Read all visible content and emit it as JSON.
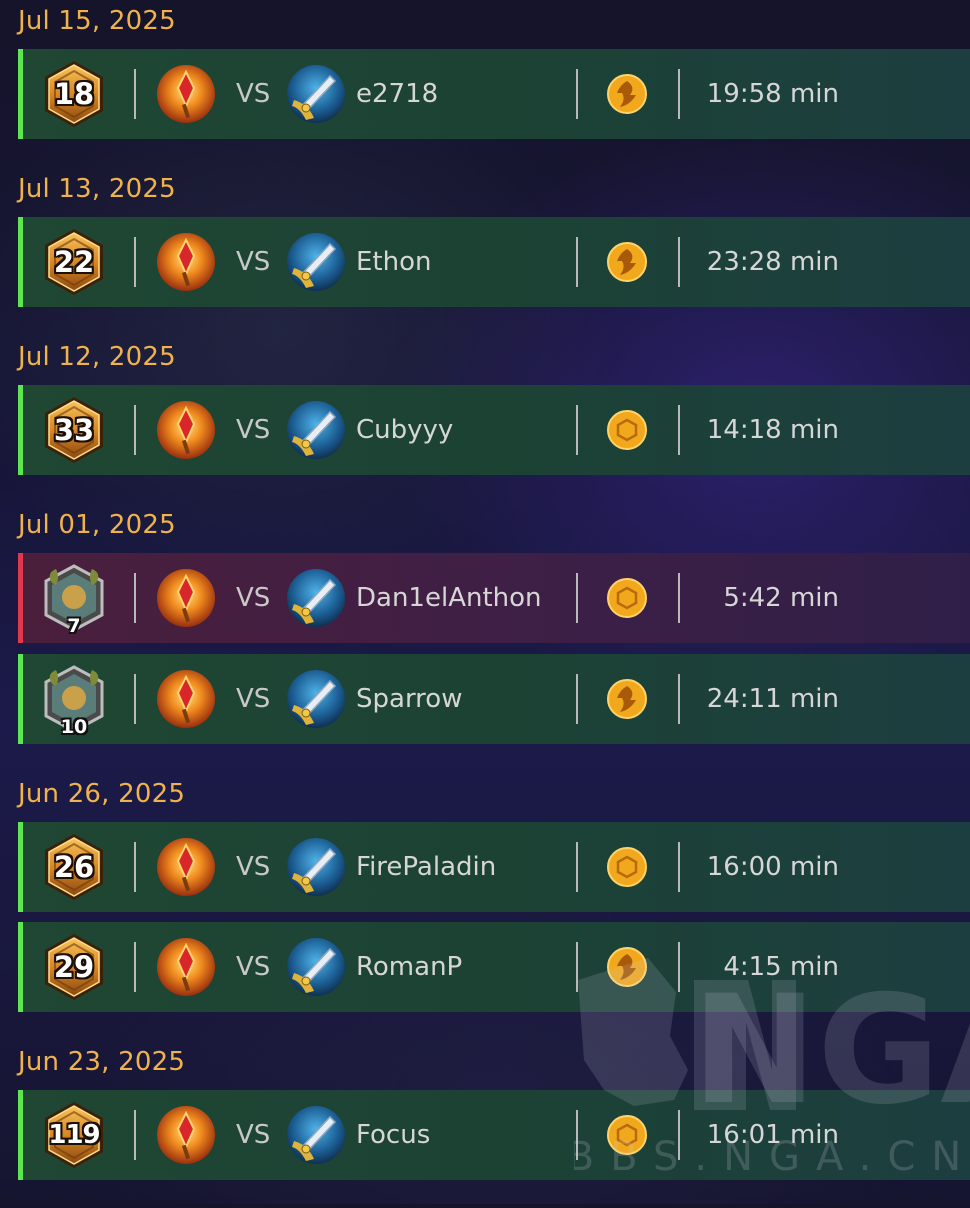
{
  "vs_label": "VS",
  "colors": {
    "date_text": "#f0b24a",
    "win_bar": "#5ce64f",
    "loss_bar": "#e0394f",
    "win_row_bg": "#1f4733",
    "loss_row_bg": "#4a1f3c"
  },
  "player_class_icon": "mage-class-icon",
  "opponent_class_icon": "warrior-class-icon",
  "groups": [
    {
      "date": "Jul 15, 2025",
      "games": [
        {
          "result": "win",
          "rank_type": "hexagon",
          "rank": "18",
          "opponent": "e2718",
          "mode_icon": "swirl-mode-icon",
          "duration": "19:58 min"
        }
      ]
    },
    {
      "date": "Jul 13, 2025",
      "games": [
        {
          "result": "win",
          "rank_type": "hexagon",
          "rank": "22",
          "opponent": "Ethon",
          "mode_icon": "swirl-mode-icon",
          "duration": "23:28 min"
        }
      ]
    },
    {
      "date": "Jul 12, 2025",
      "games": [
        {
          "result": "win",
          "rank_type": "hexagon",
          "rank": "33",
          "opponent": "Cubyyy",
          "mode_icon": "coin-mode-icon",
          "duration": "14:18 min"
        }
      ]
    },
    {
      "date": "Jul 01, 2025",
      "games": [
        {
          "result": "loss",
          "rank_type": "legend-portrait",
          "rank": "7",
          "opponent": "Dan1elAnthon",
          "mode_icon": "coin-mode-icon",
          "duration": "5:42 min"
        },
        {
          "result": "win",
          "rank_type": "legend-portrait",
          "rank": "10",
          "opponent": "Sparrow",
          "mode_icon": "swirl-mode-icon",
          "duration": "24:11 min"
        }
      ]
    },
    {
      "date": "Jun 26, 2025",
      "games": [
        {
          "result": "win",
          "rank_type": "hexagon",
          "rank": "26",
          "opponent": "FirePaladin",
          "mode_icon": "coin-mode-icon",
          "duration": "16:00 min"
        },
        {
          "result": "win",
          "rank_type": "hexagon",
          "rank": "29",
          "opponent": "RomanP",
          "mode_icon": "swirl-mode-icon",
          "duration": "4:15 min"
        }
      ]
    },
    {
      "date": "Jun 23, 2025",
      "games": [
        {
          "result": "win",
          "rank_type": "hexagon",
          "rank": "119",
          "opponent": "Focus",
          "mode_icon": "coin-mode-icon",
          "duration": "16:01 min"
        }
      ]
    }
  ],
  "watermark": {
    "logo": "NGA",
    "site": "BBS.NGA.CN"
  }
}
